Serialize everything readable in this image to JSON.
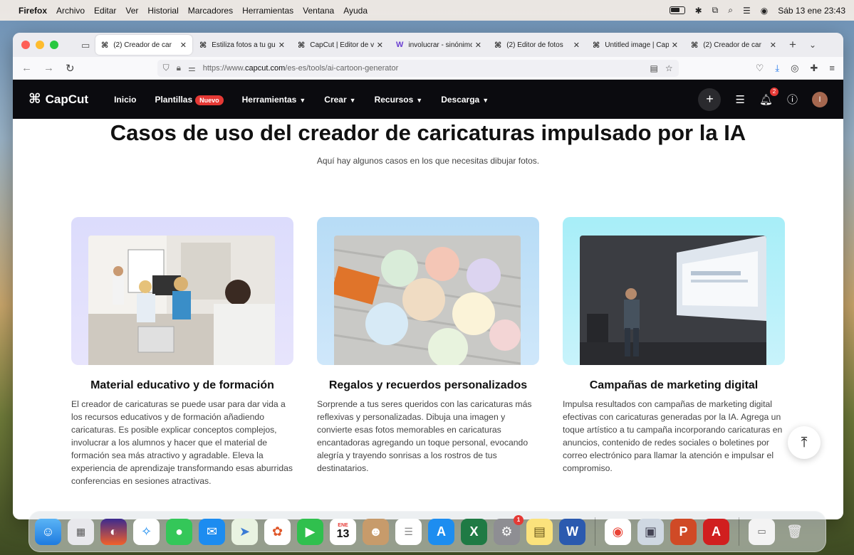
{
  "menubar": {
    "app": "Firefox",
    "items": [
      "Archivo",
      "Editar",
      "Ver",
      "Historial",
      "Marcadores",
      "Herramientas",
      "Ventana",
      "Ayuda"
    ],
    "datetime": "Sáb 13 ene 23:43"
  },
  "tabs": [
    {
      "label": "(2)  Creador de car",
      "fav": "⌘",
      "active": true
    },
    {
      "label": "Estiliza fotos a tu gus",
      "fav": "⌘",
      "active": false
    },
    {
      "label": "CapCut | Editor de vi",
      "fav": "⌘",
      "active": false
    },
    {
      "label": "involucrar - sinónimo",
      "fav": "W",
      "active": false
    },
    {
      "label": "(2)  Editor de fotos",
      "fav": "⌘",
      "active": false
    },
    {
      "label": "Untitled image | Cap",
      "fav": "⌘",
      "active": false
    },
    {
      "label": "(2)  Creador de car",
      "fav": "⌘",
      "active": false
    }
  ],
  "url": {
    "prefix": "https://www.",
    "domain": "capcut.com",
    "path": "/es-es/tools/ai-cartoon-generator"
  },
  "site": {
    "logo": "CapCut",
    "nav": {
      "inicio": "Inicio",
      "plantillas": "Plantillas",
      "nuevo": "Nuevo",
      "herramientas": "Herramientas",
      "crear": "Crear",
      "recursos": "Recursos",
      "descarga": "Descarga"
    },
    "notif_count": "2",
    "avatar": "I"
  },
  "main": {
    "title": "Casos de uso del creador de caricaturas impulsado por la IA",
    "subtitle": "Aquí hay algunos casos en los que necesitas dibujar fotos.",
    "cards": [
      {
        "title": "Material educativo y de formación",
        "body": "El creador de caricaturas se puede usar para dar vida a los recursos educativos y de formación añadiendo caricaturas. Es posible explicar conceptos complejos, involucrar a los alumnos y hacer que el material de formación sea más atractivo y agradable. Eleva la experiencia de aprendizaje transformando esas aburridas conferencias en sesiones atractivas."
      },
      {
        "title": "Regalos y recuerdos personalizados",
        "body": "Sorprende a tus seres queridos con las caricaturas más reflexivas y personalizadas. Dibuja una imagen y convierte esas fotos memorables en caricaturas encantadoras agregando un toque personal, evocando alegría y trayendo sonrisas a los rostros de tus destinatarios."
      },
      {
        "title": "Campañas de marketing digital",
        "body": "Impulsa resultados con campañas de marketing digital efectivas con caricaturas generadas por la IA. Agrega un toque artístico a tu campaña incorporando caricaturas en anuncios, contenido de redes sociales o boletines por correo electrónico para llamar la atención e impulsar el compromiso."
      }
    ]
  },
  "dock": {
    "calendar_month": "ENE",
    "calendar_day": "13",
    "settings_badge": "1"
  }
}
